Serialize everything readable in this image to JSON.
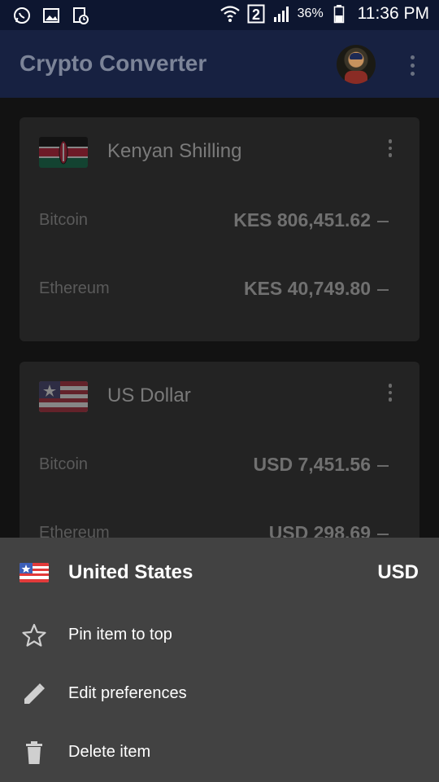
{
  "status_bar": {
    "battery_pct": "36%",
    "time": "11:36 PM",
    "sim_label": "2",
    "icons": [
      "whatsapp-icon",
      "gallery-icon",
      "clipboard-icon",
      "wifi-icon",
      "sim-2-icon",
      "signal-icon",
      "battery-icon"
    ]
  },
  "app_bar": {
    "title": "Crypto Converter",
    "icons": [
      "avatar",
      "overflow-menu-icon"
    ]
  },
  "cards": [
    {
      "currency": "Kenyan Shilling",
      "flag": "kenya-flag-icon",
      "rows": [
        {
          "label": "Bitcoin",
          "value": "KES 806,451.62"
        },
        {
          "label": "Ethereum",
          "value": "KES 40,749.80"
        }
      ]
    },
    {
      "currency": "US Dollar",
      "flag": "us-flag-icon",
      "rows": [
        {
          "label": "Bitcoin",
          "value": "USD 7,451.56"
        },
        {
          "label": "Ethereum",
          "value": "USD 298.69"
        }
      ]
    }
  ],
  "sheet": {
    "country": "United States",
    "code": "USD",
    "items": [
      {
        "label": "Pin item to top",
        "icon": "star-outline-icon"
      },
      {
        "label": "Edit preferences",
        "icon": "pencil-icon"
      },
      {
        "label": "Delete item",
        "icon": "trash-icon"
      }
    ]
  },
  "colors": {
    "app_bar": "#172141",
    "status_bar": "#0d1630",
    "card": "#232323",
    "sheet": "#424242",
    "scrim_bg": "#121212"
  }
}
